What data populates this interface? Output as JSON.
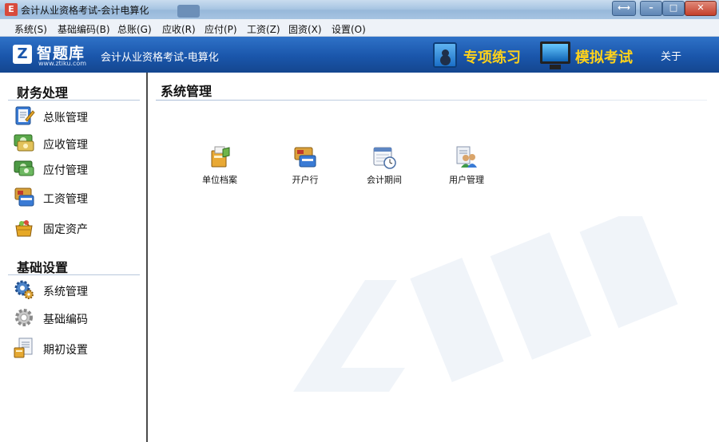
{
  "window": {
    "title": "会计从业资格考试-会计电算化",
    "app_icon_glyph": "E",
    "controls": {
      "restore": "⟷",
      "minimize": "–",
      "maximize": "□",
      "close": "✕"
    }
  },
  "menu": {
    "items": [
      {
        "label": "系统(S)"
      },
      {
        "label": "基础编码(B)"
      },
      {
        "label": "总账(G)"
      },
      {
        "label": "应收(R)"
      },
      {
        "label": "应付(P)"
      },
      {
        "label": "工资(Z)"
      },
      {
        "label": "固资(X)"
      },
      {
        "label": "设置(O)"
      }
    ]
  },
  "banner": {
    "logo_mark": "Z",
    "logo_text": "智题库",
    "logo_url": "www.ztiku.com",
    "subtitle": "会计从业资格考试-电算化",
    "practice_label": "专项练习",
    "exam_label": "模拟考试",
    "about_label": "关于",
    "accent_color": "#ffd21a",
    "banner_color": "#1a56ab"
  },
  "sidebar": {
    "sections": [
      {
        "title": "财务处理",
        "items": [
          {
            "label": "总账管理",
            "icon": "ledger-icon"
          },
          {
            "label": "应收管理",
            "icon": "receivable-icon"
          },
          {
            "label": "应付管理",
            "icon": "payable-icon"
          },
          {
            "label": "工资管理",
            "icon": "payroll-icon"
          },
          {
            "label": "固定资产",
            "icon": "fixed-asset-icon"
          }
        ]
      },
      {
        "title": "基础设置",
        "items": [
          {
            "label": "系统管理",
            "icon": "system-gear-icon"
          },
          {
            "label": "基础编码",
            "icon": "base-code-gear-icon"
          },
          {
            "label": "期初设置",
            "icon": "initial-setup-icon"
          }
        ]
      }
    ]
  },
  "main": {
    "title": "系统管理",
    "tools": [
      {
        "label": "单位档案",
        "icon": "company-archive-icon"
      },
      {
        "label": "开户行",
        "icon": "bank-card-icon"
      },
      {
        "label": "会计期间",
        "icon": "calendar-clock-icon"
      },
      {
        "label": "用户管理",
        "icon": "users-icon"
      }
    ]
  }
}
